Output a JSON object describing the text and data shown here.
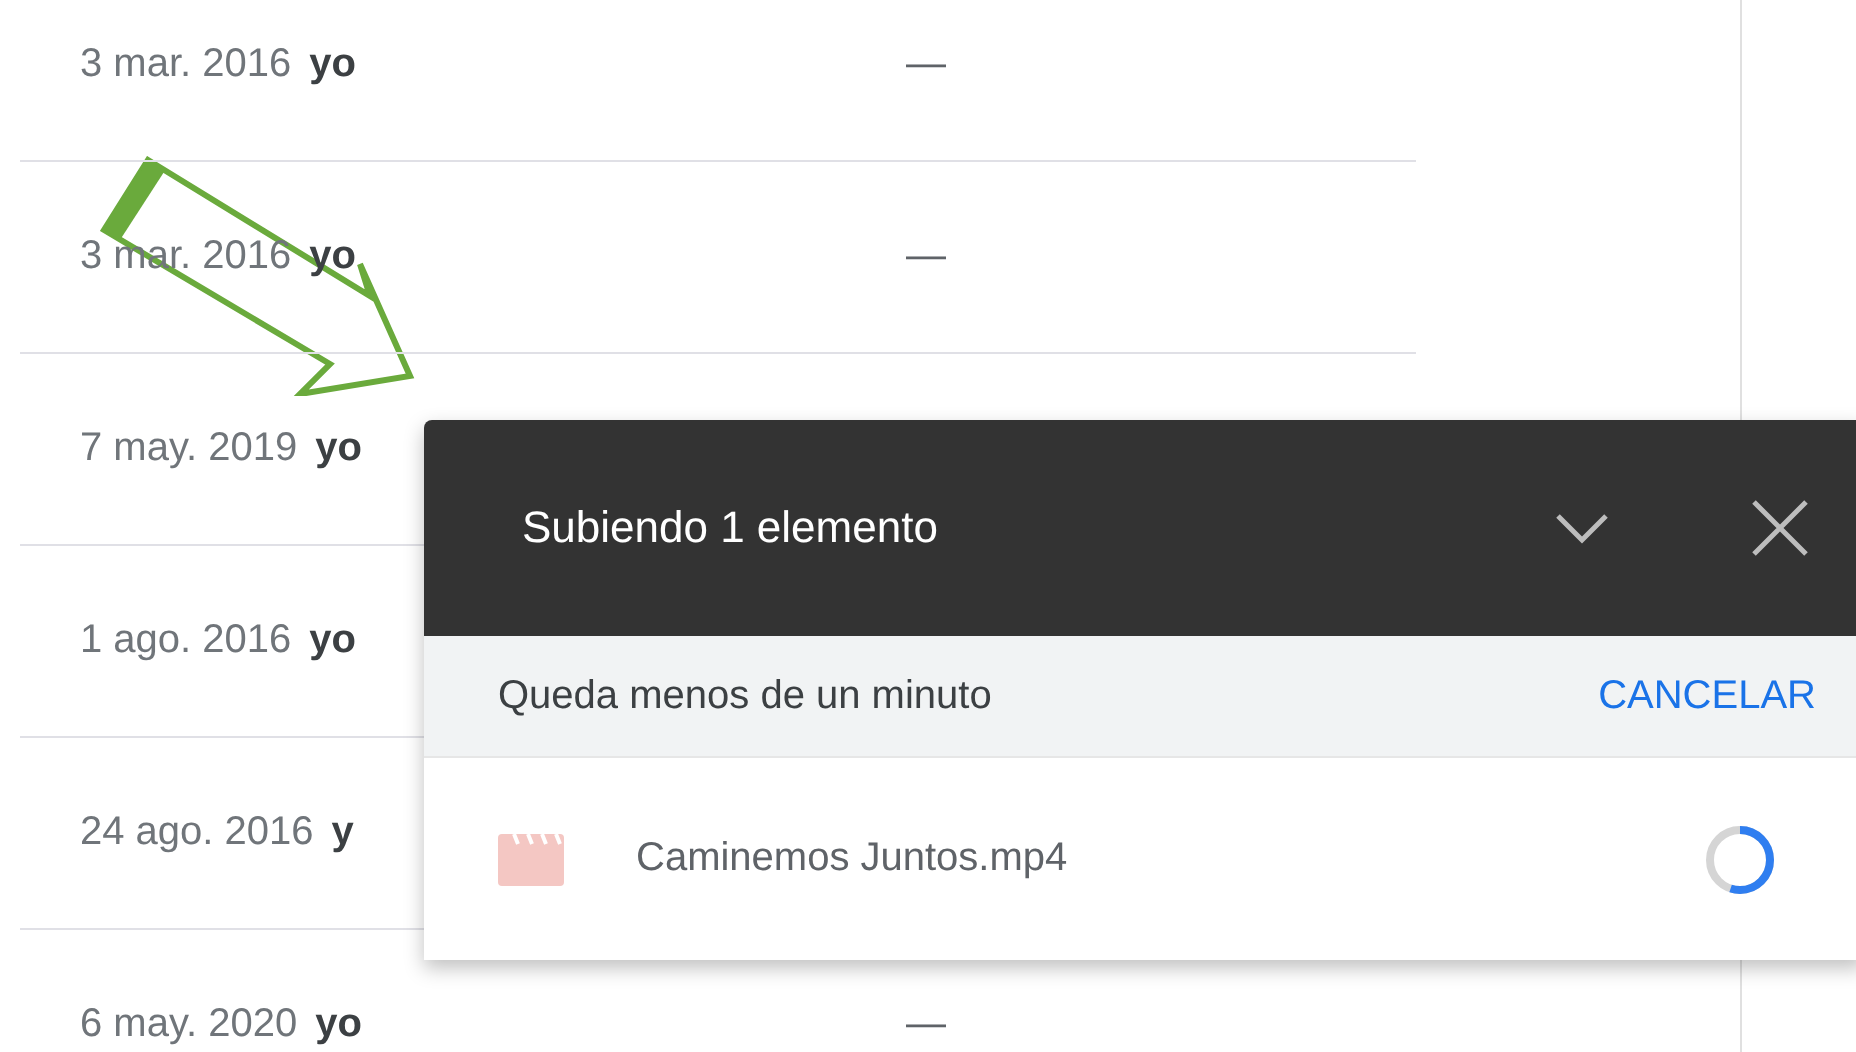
{
  "rows": [
    {
      "date": "3 mar. 2016",
      "owner": "yo",
      "size": "—"
    },
    {
      "date": "3 mar. 2016",
      "owner": "yo",
      "size": "—"
    },
    {
      "date": "7 may. 2019",
      "owner": "yo"
    },
    {
      "date": "1 ago. 2016",
      "owner": "yo"
    },
    {
      "date": "24 ago. 2016",
      "owner": "y"
    },
    {
      "date": "6 may. 2020",
      "owner": "yo",
      "size": "—"
    }
  ],
  "upload_panel": {
    "title": "Subiendo 1 elemento",
    "status": "Queda menos de un minuto",
    "cancel": "CANCELAR",
    "items": [
      {
        "name": "Caminemos Juntos.mp4",
        "level": 0.55
      }
    ]
  }
}
